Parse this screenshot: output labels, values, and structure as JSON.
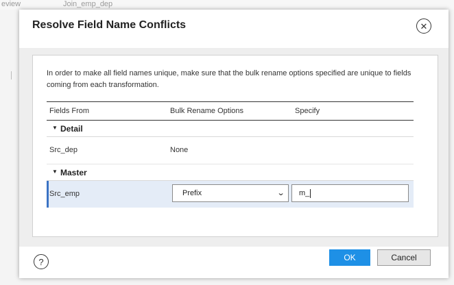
{
  "background": {
    "tab_left": "eview",
    "tab_right": "Join_emp_dep"
  },
  "dialog": {
    "title": "Resolve Field Name Conflicts",
    "close_icon": "close-circle-icon",
    "intro": "In order to make all field names unique, make sure that the bulk rename options specified are unique to fields coming from each transformation.",
    "columns": {
      "fields_from": "Fields From",
      "bulk_rename": "Bulk Rename Options",
      "specify": "Specify"
    },
    "groups": [
      {
        "name": "Detail",
        "expanded": true,
        "rows": [
          {
            "field": "Src_dep",
            "option": "None",
            "specify": ""
          }
        ]
      },
      {
        "name": "Master",
        "expanded": true,
        "rows": [
          {
            "field": "Src_emp",
            "option": "Prefix",
            "specify": "m_",
            "selected": true
          }
        ]
      }
    ],
    "footer": {
      "help_icon": "question-circle-icon",
      "ok_label": "OK",
      "cancel_label": "Cancel"
    }
  },
  "colors": {
    "primary_button": "#1e90e6",
    "selected_row": "#e4ecf7",
    "selected_accent": "#3b73c4"
  }
}
